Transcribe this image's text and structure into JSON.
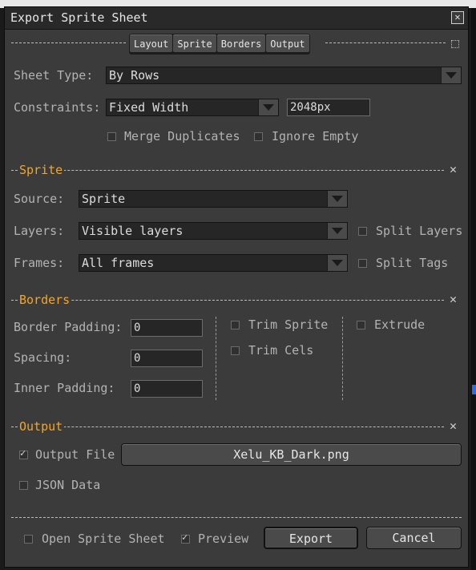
{
  "window": {
    "title": "Export Sprite Sheet"
  },
  "tabs": [
    "Layout",
    "Sprite",
    "Borders",
    "Output"
  ],
  "layout": {
    "sheet_type_label": "Sheet Type:",
    "sheet_type_value": "By Rows",
    "constraints_label": "Constraints:",
    "constraints_value": "Fixed Width",
    "constraints_size": "2048px",
    "merge_duplicates": {
      "label": "Merge Duplicates",
      "checked": false
    },
    "ignore_empty": {
      "label": "Ignore Empty",
      "checked": false
    }
  },
  "sprite": {
    "section_title": "Sprite",
    "source_label": "Source:",
    "source_value": "Sprite",
    "layers_label": "Layers:",
    "layers_value": "Visible layers",
    "frames_label": "Frames:",
    "frames_value": "All frames",
    "split_layers": {
      "label": "Split Layers",
      "checked": false
    },
    "split_tags": {
      "label": "Split Tags",
      "checked": false
    }
  },
  "borders": {
    "section_title": "Borders",
    "border_padding_label": "Border Padding:",
    "border_padding_value": "0",
    "spacing_label": "Spacing:",
    "spacing_value": "0",
    "inner_padding_label": "Inner Padding:",
    "inner_padding_value": "0",
    "trim_sprite": {
      "label": "Trim Sprite",
      "checked": false
    },
    "trim_cels": {
      "label": "Trim Cels",
      "checked": false
    },
    "extrude": {
      "label": "Extrude",
      "checked": false
    }
  },
  "output": {
    "section_title": "Output",
    "output_file": {
      "label": "Output File",
      "checked": true
    },
    "output_file_name": "Xelu_KB_Dark.png",
    "json_data": {
      "label": "JSON Data",
      "checked": false
    }
  },
  "footer": {
    "open_sprite_sheet": {
      "label": "Open Sprite Sheet",
      "checked": false
    },
    "preview": {
      "label": "Preview",
      "checked": true
    },
    "export_label": "Export",
    "cancel_label": "Cancel"
  },
  "icons": {
    "close": "close-icon",
    "collapse": "x-icon",
    "dropdown": "chevron-down-icon"
  },
  "colors": {
    "section_title": "#f5a623",
    "window_bg": "#3b3b3b"
  }
}
